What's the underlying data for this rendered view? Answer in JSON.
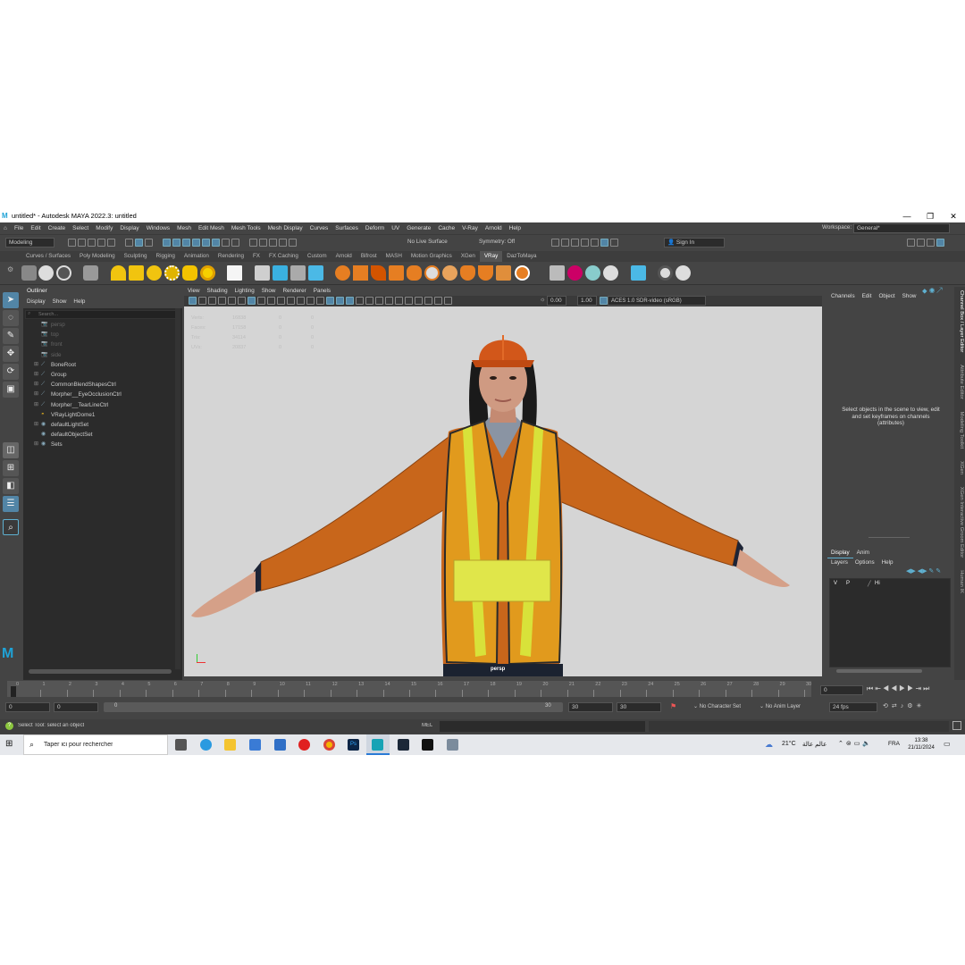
{
  "window": {
    "title": "untitled* - Autodesk MAYA 2022.3: untitled",
    "min": "—",
    "max": "❐",
    "close": "✕"
  },
  "menus": [
    "File",
    "Edit",
    "Create",
    "Select",
    "Modify",
    "Display",
    "Windows",
    "Mesh",
    "Edit Mesh",
    "Mesh Tools",
    "Mesh Display",
    "Curves",
    "Surfaces",
    "Deform",
    "UV",
    "Generate",
    "Cache",
    "V-Ray",
    "Arnold",
    "Help"
  ],
  "workspace": {
    "label": "Workspace:",
    "value": "General*"
  },
  "statusline": {
    "mode": "Modeling",
    "live_surface": "No Live Surface",
    "symmetry": "Symmetry: Off",
    "sign_in": "Sign In"
  },
  "shelf_tabs": [
    "Curves / Surfaces",
    "Poly Modeling",
    "Sculpting",
    "Rigging",
    "Animation",
    "Rendering",
    "FX",
    "FX Caching",
    "Custom",
    "Arnold",
    "Bifrost",
    "MASH",
    "Motion Graphics",
    "XGen",
    "VRay",
    "DazToMaya"
  ],
  "shelf_active": "VRay",
  "outliner": {
    "title": "Outliner",
    "menu": [
      "Display",
      "Show",
      "Help"
    ],
    "search_placeholder": "Search...",
    "items": [
      {
        "label": "persp",
        "dim": true
      },
      {
        "label": "top",
        "dim": true
      },
      {
        "label": "front",
        "dim": true
      },
      {
        "label": "side",
        "dim": true
      },
      {
        "label": "BoneRoot",
        "dim": false
      },
      {
        "label": "Group",
        "dim": false
      },
      {
        "label": "CommonBlendShapesCtrl",
        "dim": false
      },
      {
        "label": "Morpher__EyeOcclusionCtrl",
        "dim": false
      },
      {
        "label": "Morpher__TearLineCtrl",
        "dim": false
      },
      {
        "label": "VRayLightDome1",
        "dim": false
      },
      {
        "label": "defaultLightSet",
        "dim": false
      },
      {
        "label": "defaultObjectSet",
        "dim": false
      },
      {
        "label": "Sets",
        "dim": false
      }
    ]
  },
  "viewport": {
    "menu": [
      "View",
      "Shading",
      "Lighting",
      "Show",
      "Renderer",
      "Panels"
    ],
    "exposure": "0.00",
    "gamma": "1.00",
    "colorspace": "ACES 1.0 SDR-video (sRGB)",
    "camera_label": "persp",
    "hud": [
      {
        "label": "Verts:",
        "v1": "16838",
        "v2": "0",
        "v3": "0"
      },
      {
        "label": "Faces:",
        "v1": "17158",
        "v2": "0",
        "v3": "0"
      },
      {
        "label": "Tris:",
        "v1": "34114",
        "v2": "0",
        "v3": "0"
      },
      {
        "label": "UVs:",
        "v1": "20837",
        "v2": "0",
        "v3": "0"
      }
    ]
  },
  "channelbox": {
    "menu": [
      "Channels",
      "Edit",
      "Object",
      "Show"
    ],
    "message": "Select objects in the scene to view, edit and set keyframes on channels (attributes)"
  },
  "layers": {
    "tabs": [
      "Display",
      "Anim"
    ],
    "menu": [
      "Layers",
      "Options",
      "Help"
    ],
    "row": {
      "v": "V",
      "p": "P",
      "name": "Hi"
    }
  },
  "right_tabs": [
    "Channel Box / Layer Editor",
    "Attribute Editor",
    "Modeling Toolkit",
    "XGen",
    "XGen Interactive Groom Editor",
    "Human IK"
  ],
  "timeline": {
    "ticks": [
      "0",
      "1",
      "2",
      "3",
      "4",
      "5",
      "6",
      "7",
      "8",
      "9",
      "10",
      "11",
      "12",
      "13",
      "14",
      "15",
      "16",
      "17",
      "18",
      "19",
      "20",
      "21",
      "22",
      "23",
      "24",
      "25",
      "26",
      "27",
      "28",
      "29",
      "30"
    ],
    "labeled_ticks": [
      "0",
      "5",
      "10",
      "15",
      "20",
      "25",
      "30"
    ],
    "current_frame": "0"
  },
  "range": {
    "start": "0",
    "anim_start": "0",
    "slider_start": "0",
    "slider_end": "30",
    "end": "30",
    "anim_end": "30",
    "char_set": "No Character Set",
    "anim_layer": "No Anim Layer",
    "fps": "24 fps"
  },
  "command": {
    "help": "Select Tool: select an object",
    "lang": "MEL"
  },
  "taskbar": {
    "search": "Taper ici pour rechercher",
    "weather": "21°C",
    "weather_text": "عالم عالة",
    "lang": "FRA",
    "time": "13:38",
    "date": "21/11/2024"
  }
}
